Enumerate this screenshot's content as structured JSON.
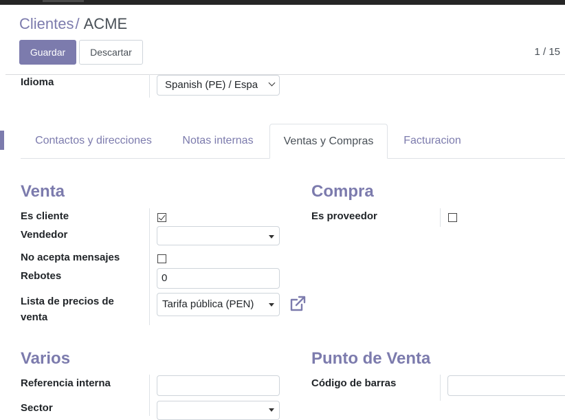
{
  "colors": {
    "accent": "#7c7bad",
    "topbar": "#262626",
    "border": "#ced4da"
  },
  "breadcrumb": {
    "parent": "Clientes",
    "separator": "/",
    "current": "ACME"
  },
  "buttons": {
    "save": "Guardar",
    "discard": "Descartar"
  },
  "pager": {
    "value": "1 / 15"
  },
  "language": {
    "label": "Idioma",
    "value": "Spanish (PE) / Espa"
  },
  "tabs": [
    {
      "label": "Contactos y direcciones",
      "active": false
    },
    {
      "label": "Notas internas",
      "active": false
    },
    {
      "label": "Ventas y Compras",
      "active": true
    },
    {
      "label": "Facturacion",
      "active": false
    }
  ],
  "sales": {
    "title": "Venta",
    "is_customer": {
      "label": "Es cliente",
      "checked": true
    },
    "salesperson": {
      "label": "Vendedor",
      "value": ""
    },
    "opt_out": {
      "label": "No acepta mensajes",
      "checked": false
    },
    "bounces": {
      "label": "Rebotes",
      "value": "0"
    },
    "pricelist": {
      "label_line1": "Lista de precios de",
      "label_line2": "venta",
      "value": "Tarifa pública (PEN)",
      "link_icon": "external-link-icon"
    }
  },
  "purchase": {
    "title": "Compra",
    "is_supplier": {
      "label": "Es proveedor",
      "checked": false
    }
  },
  "misc": {
    "title": "Varios",
    "internal_ref": {
      "label": "Referencia interna",
      "value": ""
    },
    "sector": {
      "label": "Sector",
      "value": ""
    }
  },
  "pos": {
    "title": "Punto de Venta",
    "barcode": {
      "label": "Código de barras",
      "value": ""
    }
  }
}
